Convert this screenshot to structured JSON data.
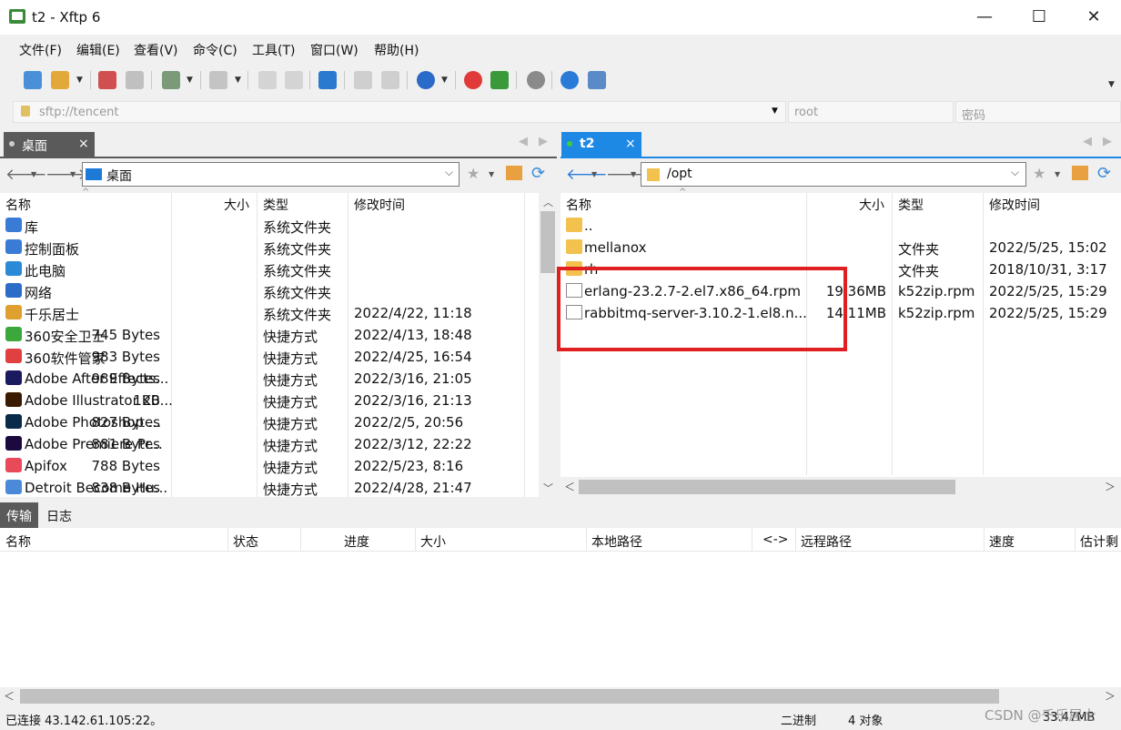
{
  "window": {
    "title": "t2 - Xftp 6",
    "minimize": "—",
    "maximize": "☐",
    "close": "✕"
  },
  "menu": [
    "文件(F)",
    "编辑(E)",
    "查看(V)",
    "命令(C)",
    "工具(T)",
    "窗口(W)",
    "帮助(H)"
  ],
  "address": {
    "host_placeholder": "sftp://tencent",
    "user_placeholder": "root",
    "password_placeholder": "密码"
  },
  "left_pane": {
    "tab_label": "桌面",
    "tab_close": "×",
    "path": "桌面",
    "columns": [
      "名称",
      "大小",
      "类型",
      "修改时间"
    ],
    "rows": [
      {
        "name": "库",
        "size": "",
        "type": "系统文件夹",
        "modified": "",
        "icon": "library-icon",
        "color": "#3a7bd5"
      },
      {
        "name": "控制面板",
        "size": "",
        "type": "系统文件夹",
        "modified": "",
        "icon": "control-panel-icon",
        "color": "#3a7bd5"
      },
      {
        "name": "此电脑",
        "size": "",
        "type": "系统文件夹",
        "modified": "",
        "icon": "computer-icon",
        "color": "#2a8ad8"
      },
      {
        "name": "网络",
        "size": "",
        "type": "系统文件夹",
        "modified": "",
        "icon": "network-icon",
        "color": "#2a6cc8"
      },
      {
        "name": "千乐居士",
        "size": "",
        "type": "系统文件夹",
        "modified": "2022/4/22, 11:18",
        "icon": "user-folder-icon",
        "color": "#e0a030"
      },
      {
        "name": "360安全卫士",
        "size": "745 Bytes",
        "type": "快捷方式",
        "modified": "2022/4/13, 18:48",
        "icon": "360-security-icon",
        "color": "#3ca83c"
      },
      {
        "name": "360软件管家",
        "size": "983 Bytes",
        "type": "快捷方式",
        "modified": "2022/4/25, 16:54",
        "icon": "360-software-icon",
        "color": "#e04040"
      },
      {
        "name": "Adobe After Effects...",
        "size": "989 Bytes",
        "type": "快捷方式",
        "modified": "2022/3/16, 21:05",
        "icon": "after-effects-icon",
        "color": "#1a1a5e"
      },
      {
        "name": "Adobe Illustrator 20...",
        "size": "1KB",
        "type": "快捷方式",
        "modified": "2022/3/16, 21:13",
        "icon": "illustrator-icon",
        "color": "#3a1a00"
      },
      {
        "name": "Adobe Photoshop ...",
        "size": "827 Bytes",
        "type": "快捷方式",
        "modified": "2022/2/5, 20:56",
        "icon": "photoshop-icon",
        "color": "#0a2a4a"
      },
      {
        "name": "Adobe Premiere Pr...",
        "size": "881 Bytes",
        "type": "快捷方式",
        "modified": "2022/3/12, 22:22",
        "icon": "premiere-icon",
        "color": "#1a0a3e"
      },
      {
        "name": "Apifox",
        "size": "788 Bytes",
        "type": "快捷方式",
        "modified": "2022/5/23, 8:16",
        "icon": "apifox-icon",
        "color": "#e84a5a"
      },
      {
        "name": "Detroit Become Hu...",
        "size": "838 Bytes",
        "type": "快捷方式",
        "modified": "2022/4/28, 21:47",
        "icon": "game-shortcut-icon",
        "color": "#4a8ad8"
      }
    ]
  },
  "right_pane": {
    "tab_label": "t2",
    "tab_close": "×",
    "path": "/opt",
    "columns": [
      "名称",
      "大小",
      "类型",
      "修改时间"
    ],
    "rows": [
      {
        "name": "..",
        "size": "",
        "type": "",
        "modified": "",
        "icon": "folder-icon"
      },
      {
        "name": "mellanox",
        "size": "",
        "type": "文件夹",
        "modified": "2022/5/25, 15:02",
        "icon": "folder-icon"
      },
      {
        "name": "rh",
        "size": "",
        "type": "文件夹",
        "modified": "2018/10/31, 3:17",
        "icon": "folder-icon"
      },
      {
        "name": "erlang-23.2.7-2.el7.x86_64.rpm",
        "size": "19.36MB",
        "type": "k52zip.rpm",
        "modified": "2022/5/25, 15:29",
        "icon": "file-icon"
      },
      {
        "name": "rabbitmq-server-3.10.2-1.el8.n...",
        "size": "14.11MB",
        "type": "k52zip.rpm",
        "modified": "2022/5/25, 15:29",
        "icon": "file-icon"
      }
    ]
  },
  "transfer": {
    "tabs": [
      "传输",
      "日志"
    ],
    "columns": [
      "名称",
      "状态",
      "进度",
      "大小",
      "本地路径",
      "<->",
      "远程路径",
      "速度",
      "估计剩"
    ]
  },
  "status": {
    "connection": "已连接 43.142.61.105:22。",
    "mode": "二进制",
    "objects": "4 对象",
    "size": "33.47MB",
    "watermark": "CSDN @千乐居士"
  },
  "colors": {
    "accent": "#1e88e5",
    "highlight_box": "#e02020"
  }
}
